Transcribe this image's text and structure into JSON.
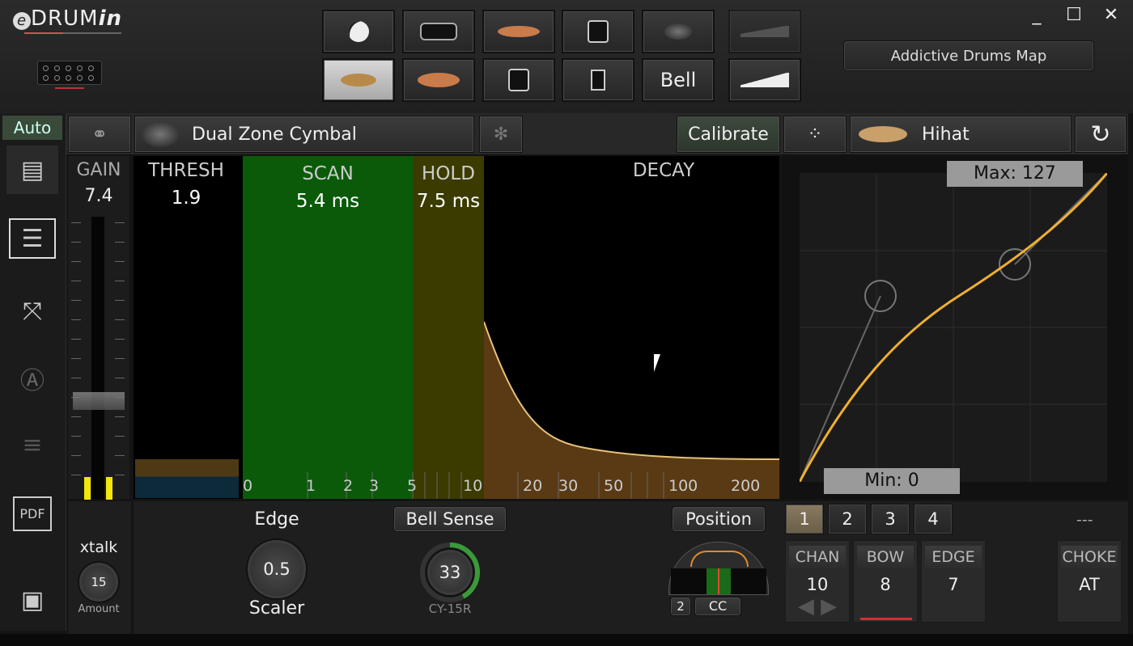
{
  "app": {
    "logo_prefix": "e",
    "logo_main": "DRUM",
    "logo_suffix": "in"
  },
  "window": {
    "minimize": "_",
    "maximize": "☐",
    "close": "✕"
  },
  "map_button": "Addictive Drums Map",
  "pad_row2_bell": "Bell",
  "sidebar": {
    "auto": "Auto"
  },
  "header": {
    "pad_type": "Dual Zone Cymbal",
    "calibrate": "Calibrate",
    "instrument": "Hihat"
  },
  "gain": {
    "title": "GAIN",
    "value": "7.4",
    "level": 0.35
  },
  "thresh": {
    "title": "THRESH",
    "value": "1.9"
  },
  "scan": {
    "title": "SCAN",
    "value": "5.4 ms"
  },
  "hold": {
    "title": "HOLD",
    "value": "7.5 ms"
  },
  "decay": {
    "title": "DECAY"
  },
  "axis_labels": [
    "0",
    "1",
    "2",
    "3",
    "5",
    "10",
    "20",
    "30",
    "50",
    "100",
    "200"
  ],
  "curve": {
    "max": "Max: 127",
    "min": "Min: 0"
  },
  "xtalk": {
    "title": "xtalk",
    "value": "15",
    "sub": "Amount"
  },
  "edge": {
    "title": "Edge",
    "value": "0.5",
    "sub": "Scaler"
  },
  "bell": {
    "title": "Bell Sense",
    "value": "33",
    "sub": "CY-15R",
    "level": 0.33
  },
  "position": {
    "title": "Position",
    "num": "2",
    "cc": "CC"
  },
  "layers": [
    "1",
    "2",
    "3",
    "4"
  ],
  "layers_right": "---",
  "midi": {
    "chan_h": "CHAN",
    "chan_v": "10",
    "bow_h": "BOW",
    "bow_v": "8",
    "edge_h": "EDGE",
    "edge_v": "7",
    "choke_h": "CHOKE",
    "choke_v": "AT"
  },
  "colors": {
    "scan": "#0a5a0a",
    "hold": "#3b3b00",
    "curve": "#f0b030",
    "decay_fill": "#5a3a14",
    "vu": "#f3e60a"
  }
}
